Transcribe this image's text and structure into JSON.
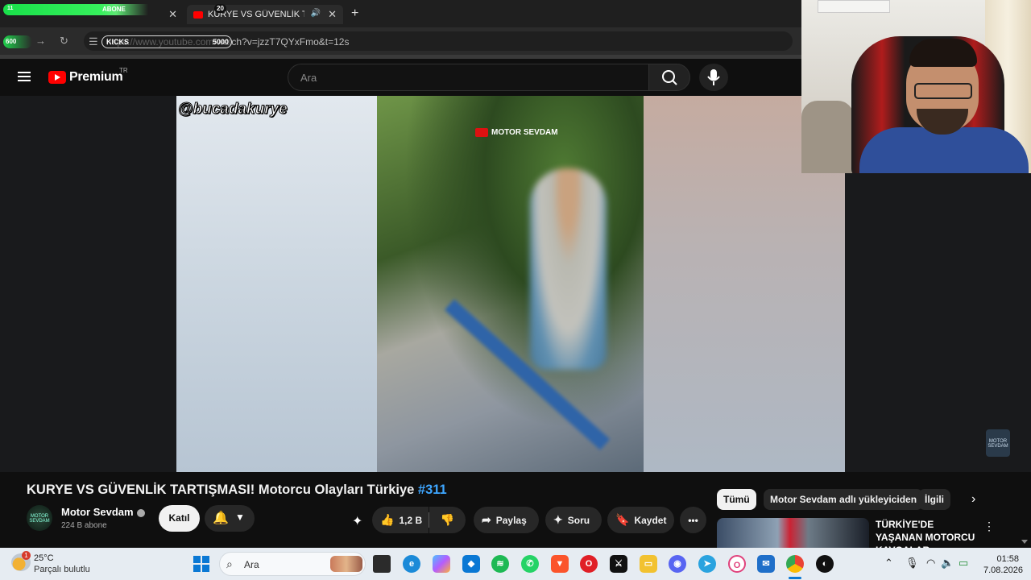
{
  "browser": {
    "tab1_overlay_label": "ABONE",
    "tab1_overlay_small": "11",
    "tab1_badge": "20",
    "tab2_title": "KURYE VS GÜVENLİK TARTI",
    "url": "https://www.youtube.com/watch?v=jzzT7QYxFmo&t=12s",
    "kicks_label": "KICKS",
    "kicks_value": "5000",
    "counter_600": "600"
  },
  "youtube": {
    "logo_text": "Premium",
    "logo_region": "TR",
    "search_placeholder": "Ara",
    "video": {
      "watermark": "@bucadakurye",
      "channel_logo": "MOTOR SEVDAM",
      "corner_watermark": "MOTOR SEVDAM"
    },
    "title_main": "KURYE VS GÜVENLİK TARTIŞMASI! Motorcu Olayları Türkiye",
    "title_hashtag": "#311",
    "channel": {
      "name": "Motor Sevdam",
      "subscribers": "224 B abone",
      "avatar_text": "MOTOR SEVDAM"
    },
    "actions": {
      "join": "Katıl",
      "likes": "1,2 B",
      "share": "Paylaş",
      "ask": "Soru",
      "save": "Kaydet"
    },
    "chips": [
      "Tümü",
      "Motor Sevdam adlı yükleyiciden",
      "İlgili"
    ],
    "recommended": {
      "title": "TÜRKİYE'DE YAŞANAN MOTORCU KAVGALAR..."
    }
  },
  "taskbar": {
    "temperature": "25°C",
    "weather": "Parçalı bulutlu",
    "weather_badge": "1",
    "search_placeholder": "Ara",
    "time": "01:58",
    "date": "7.08.2026"
  },
  "colors": {
    "accent_link": "#3ea6ff",
    "youtube_red": "#ff0000",
    "windows_blue": "#0a78d4"
  }
}
